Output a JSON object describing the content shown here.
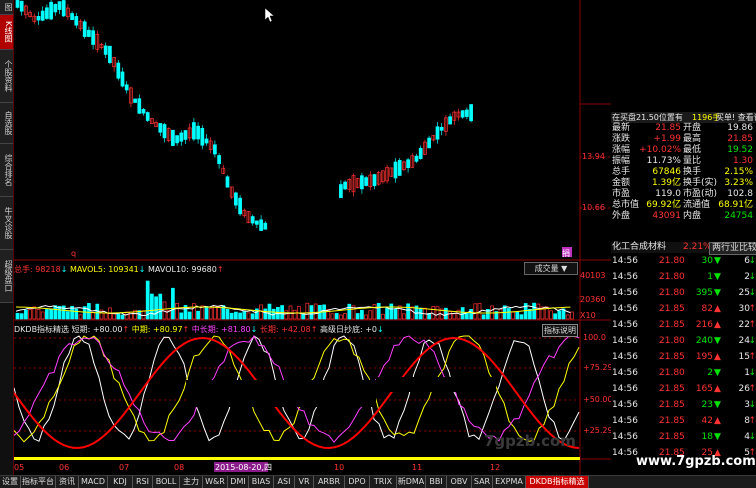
{
  "left_nav": [
    "图",
    "K线图",
    "个股资料",
    "自选股",
    "综合排名",
    "牛叉诊股",
    "超级盘口"
  ],
  "price_axis": [
    "13.94",
    "10.66"
  ],
  "volume_header": {
    "total": "总手: 98218",
    "ma5": "MAVOL5: 109341",
    "ma10": "MAVOL10: 99680",
    "indicator_select": "成交量"
  },
  "volume_axis": [
    "40103",
    "20360",
    "X10"
  ],
  "indicator_header": {
    "name": "DKDB指标精选",
    "short": "短期: +80.00",
    "mid": "中期: +80.97",
    "midlong": "中长期: +81.80",
    "long": "长期: +42.08",
    "low": "高级日抄底: +0",
    "help": "指标说明"
  },
  "indicator_axis": [
    "100.0",
    "+75.29",
    "+50.00",
    "+25.29"
  ],
  "date_axis": [
    "05",
    "06",
    "07",
    "08",
    "2015-08-20,四",
    "10",
    "11",
    "12"
  ],
  "marker_q": "q",
  "marker_jian": "捐",
  "quote_header": {
    "left": "在买盘21.50位置有",
    "mid": "1196手",
    "right": "买单! 查看详细"
  },
  "quotes": [
    {
      "l1": "最新",
      "v1": "21.85",
      "c1": "red",
      "l2": "开盘",
      "v2": "19.86",
      "c2": "white"
    },
    {
      "l1": "涨跌",
      "v1": "+1.99",
      "c1": "red",
      "l2": "最高",
      "v2": "21.85",
      "c2": "red"
    },
    {
      "l1": "涨幅",
      "v1": "+10.02%",
      "c1": "red",
      "l2": "最低",
      "v2": "19.52",
      "c2": "green"
    },
    {
      "l1": "振幅",
      "v1": "11.73%",
      "c1": "white",
      "l2": "量比",
      "v2": "1.30",
      "c2": "red"
    },
    {
      "l1": "总手",
      "v1": "67846",
      "c1": "yel",
      "l2": "换手",
      "v2": "2.15%",
      "c2": "yel"
    },
    {
      "l1": "金额",
      "v1": "1.39亿",
      "c1": "yel",
      "l2": "换手(实)",
      "v2": "3.23%",
      "c2": "yel"
    },
    {
      "l1": "市盈",
      "v1": "119.0",
      "c1": "white",
      "l2": "市盈(动)",
      "v2": "102.8",
      "c2": "white"
    },
    {
      "l1": "总市值",
      "v1": "69.92亿",
      "c1": "yel",
      "l2": "流通值",
      "v2": "68.91亿",
      "c2": "yel"
    },
    {
      "l1": "外盘",
      "v1": "43091",
      "c1": "red",
      "l2": "内盘",
      "v2": "24754",
      "c2": "green"
    }
  ],
  "sector": {
    "name": "化工合成材料",
    "pct": "2.21%",
    "btn": "两行业比较"
  },
  "trades": [
    {
      "t": "14:56",
      "p": "21.80",
      "v": "30",
      "d": "down",
      "n": "6"
    },
    {
      "t": "14:56",
      "p": "21.80",
      "v": "1",
      "d": "down",
      "n": "2"
    },
    {
      "t": "14:56",
      "p": "21.80",
      "v": "395",
      "d": "down",
      "n": "25"
    },
    {
      "t": "14:56",
      "p": "21.85",
      "v": "82",
      "d": "up",
      "n": "30"
    },
    {
      "t": "14:56",
      "p": "21.85",
      "v": "216",
      "d": "up",
      "n": "22"
    },
    {
      "t": "14:56",
      "p": "21.80",
      "v": "240",
      "d": "down",
      "n": "24"
    },
    {
      "t": "14:56",
      "p": "21.85",
      "v": "195",
      "d": "up",
      "n": "15"
    },
    {
      "t": "14:56",
      "p": "21.80",
      "v": "2",
      "d": "down",
      "n": "1"
    },
    {
      "t": "14:56",
      "p": "21.85",
      "v": "165",
      "d": "up",
      "n": "26"
    },
    {
      "t": "14:56",
      "p": "21.85",
      "v": "23",
      "d": "down",
      "n": "3"
    },
    {
      "t": "14:56",
      "p": "21.85",
      "v": "42",
      "d": "up",
      "n": "8"
    },
    {
      "t": "14:56",
      "p": "21.85",
      "v": "18",
      "d": "down",
      "n": "4"
    },
    {
      "t": "14:56",
      "p": "21.85",
      "v": "25",
      "d": "up",
      "n": "5"
    }
  ],
  "tabs": [
    "设置",
    "指标平台",
    "资讯",
    "MACD",
    "KDJ",
    "RSI",
    "BOLL",
    "主力",
    "W&R",
    "DMI",
    "BIAS",
    "ASI",
    "VR",
    "ARBR",
    "DPO",
    "TRIX",
    "新DMA",
    "BBI",
    "OBV",
    "SAR",
    "EXPMA",
    "DKDB指标精选"
  ],
  "watermark": "www.7gpzb.com",
  "colors": {
    "up": "#ff3232",
    "down": "#00ffff",
    "short": "#ffffff",
    "mid": "#ffff00",
    "midlong": "#ff40ff",
    "long": "#ff0000",
    "grid": "#8b0000"
  }
}
